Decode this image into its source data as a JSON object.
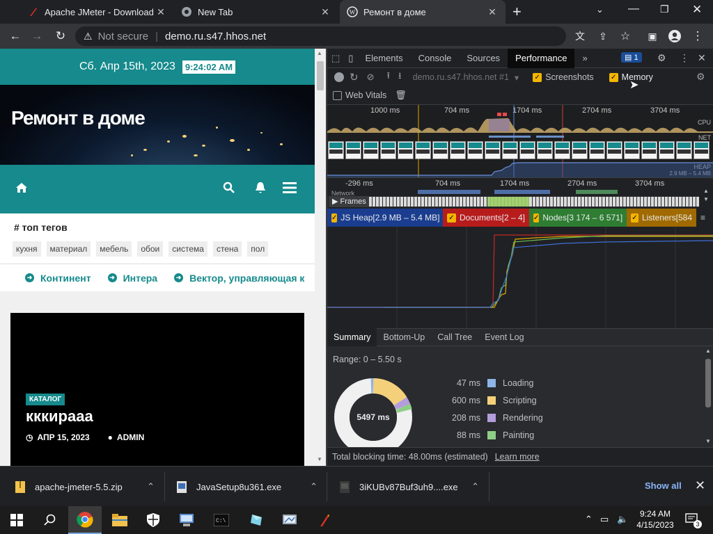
{
  "browser": {
    "tabs": [
      {
        "title": "Apache JMeter - Download Apac",
        "active": false
      },
      {
        "title": "New Tab",
        "active": false
      },
      {
        "title": "Ремонт в доме",
        "active": true
      }
    ],
    "new_tab": "+",
    "security": "Not secure",
    "url": "demo.ru.s47.hhos.net"
  },
  "page": {
    "date": "Сб. Апр 15th, 2023",
    "time": "9:24:02 AM",
    "site_title": "Ремонт в доме",
    "tags_heading": "# топ тегов",
    "tags": [
      "кухня",
      "материал",
      "мебель",
      "обои",
      "система",
      "стена",
      "пол"
    ],
    "categories": [
      "Континент",
      "Интера",
      "Вектор, управляющая к"
    ],
    "post": {
      "badge": "КАТАЛОГ",
      "title": "кккираaa",
      "date": "АПР 15, 2023",
      "author": "ADMIN"
    }
  },
  "devtools": {
    "tabs": [
      "Elements",
      "Console",
      "Sources",
      "Performance"
    ],
    "more": "»",
    "issues_count": "1",
    "profile": "demo.ru.s47.hhos.net #1",
    "screenshots_label": "Screenshots",
    "memory_label": "Memory",
    "webvitals_label": "Web Vitals",
    "overview_ticks": [
      "1000 ms",
      "704 ms",
      "1704 ms",
      "2704 ms",
      "3704 ms"
    ],
    "overview_labels": {
      "cpu": "CPU",
      "net": "NET",
      "heap": "HEAP",
      "heap_range": "2.9 MB – 5.4 MB"
    },
    "flame_ticks": [
      "-296 ms",
      "704 ms",
      "1704 ms",
      "2704 ms",
      "3704 ms"
    ],
    "network_label": "Network",
    "frames_label": "Frames",
    "counters": [
      {
        "label": "JS Heap[2.9 MB – 5.4 MB]",
        "color": "#1a3d8f"
      },
      {
        "label": "Documents[2 – 4]",
        "color": "#b71c1c"
      },
      {
        "label": "Nodes[3 174 – 6 571]",
        "color": "#2e7d32"
      },
      {
        "label": "Listeners[584",
        "color": "#a06a00"
      }
    ],
    "bottom_tabs": [
      "Summary",
      "Bottom-Up",
      "Call Tree",
      "Event Log"
    ],
    "range": "Range: 0 – 5.50 s",
    "summary": [
      {
        "ms": "47 ms",
        "label": "Loading",
        "color": "#8fb4e6"
      },
      {
        "ms": "600 ms",
        "label": "Scripting",
        "color": "#f5d07a"
      },
      {
        "ms": "208 ms",
        "label": "Rendering",
        "color": "#b39ddb"
      },
      {
        "ms": "88 ms",
        "label": "Painting",
        "color": "#8fce86"
      }
    ],
    "total_ms": "5497 ms",
    "tbt": "Total blocking time: 48.00ms (estimated)",
    "learn_more": "Learn more"
  },
  "downloads": {
    "items": [
      "apache-jmeter-5.5.zip",
      "JavaSetup8u361.exe",
      "3iKUBv87Buf3uh9....exe"
    ],
    "show_all": "Show all"
  },
  "taskbar": {
    "time": "9:24 AM",
    "date": "4/15/2023",
    "notifications": "3"
  }
}
